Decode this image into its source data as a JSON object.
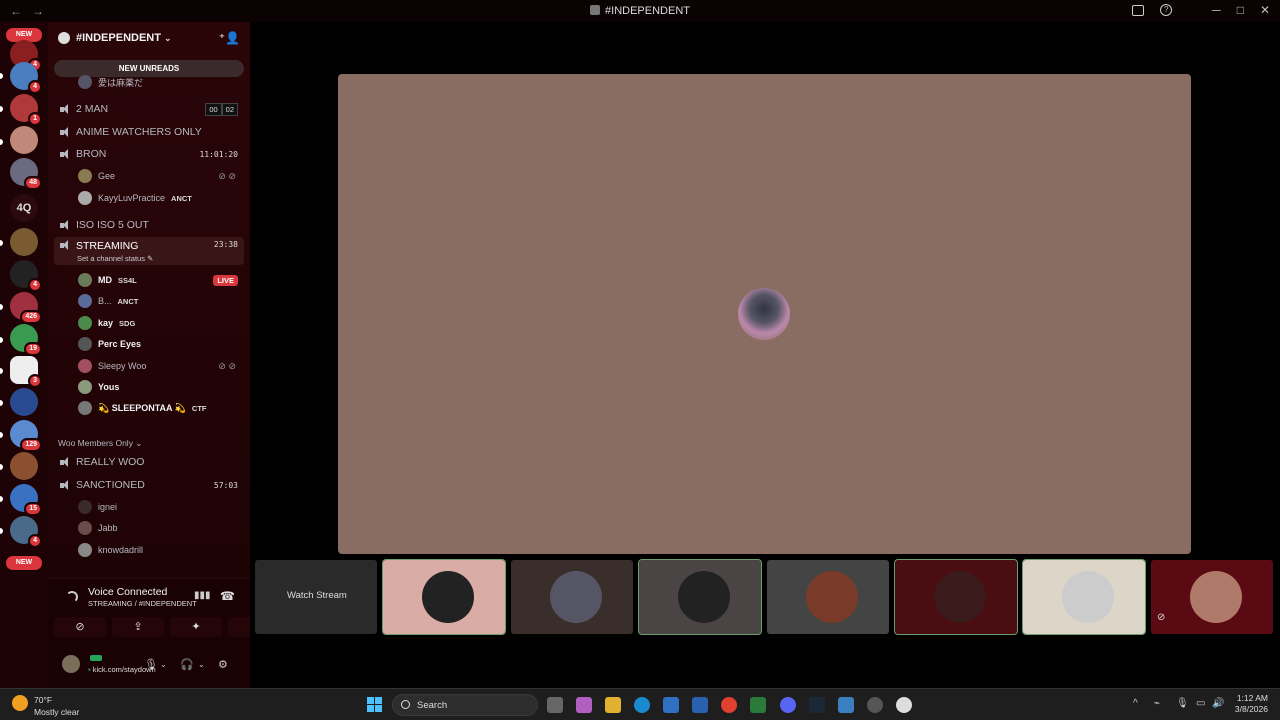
{
  "window": {
    "title": "#INDEPENDENT",
    "back_glyph": "←",
    "forward_glyph": "→",
    "minimize_glyph": "─",
    "maximize_glyph": "□",
    "close_glyph": "✕",
    "help_glyph": "?"
  },
  "servers": {
    "new_top": "NEW",
    "new_bottom": "NEW",
    "text_server": "4Q",
    "badges": [
      "4",
      "4",
      "1",
      "48",
      "4",
      "426",
      "19",
      "3",
      "129",
      "15",
      "4"
    ]
  },
  "guild": {
    "name": "#INDEPENDENT",
    "chevron": "⌄",
    "new_unreads": "NEW UNREADS",
    "invite_glyph": "⁺👤"
  },
  "channels": {
    "hidden_user": "愛は麻薬だ",
    "two_man": {
      "name": "2 MAN",
      "count_a": "00",
      "count_b": "02"
    },
    "anime": {
      "name": "ANIME WATCHERS ONLY"
    },
    "bron": {
      "name": "BRON",
      "timer": "11:01:20",
      "users": [
        {
          "name": "Gee"
        },
        {
          "name": "KayyLuvPractice",
          "tag": "ANCT"
        }
      ]
    },
    "iso": {
      "name": "ISO ISO 5 OUT"
    },
    "streaming": {
      "name": "STREAMING",
      "timer": "23:38",
      "status": "Set a channel status ✎",
      "users": [
        {
          "name": "MD",
          "tag": "SS4L",
          "live": "LIVE"
        },
        {
          "name": "B...",
          "tag": "ANCT"
        },
        {
          "name": "kay",
          "tag": "SDG"
        },
        {
          "name": "Perc Eyes"
        },
        {
          "name": "Sleepy Woo"
        },
        {
          "name": "Yous"
        },
        {
          "name": "💫 SLEEPONTAA 💫",
          "tag": "CTF"
        }
      ]
    },
    "category": "Woo Members Only ⌄",
    "really_woo": {
      "name": "REALLY WOO"
    },
    "sanctioned": {
      "name": "SANCTIONED",
      "timer": "57:03",
      "users": [
        {
          "name": "ignei"
        },
        {
          "name": "Jabb"
        },
        {
          "name": "knowdadrill"
        }
      ]
    }
  },
  "voice": {
    "title": "Voice Connected",
    "subtitle": "STREAMING / #INDEPENDENT",
    "user_status": "kick.com/staydown"
  },
  "stage": {
    "watch_stream": "Watch Stream"
  },
  "taskbar": {
    "temperature": "70°F",
    "condition": "Mostly clear",
    "search_placeholder": "Search",
    "time": "1:12 AM",
    "date": "3/8/2026"
  },
  "colors": {
    "accent_red": "#da373c",
    "speaking_green": "#6a9d6a",
    "main_tile": "#8a6d62"
  }
}
